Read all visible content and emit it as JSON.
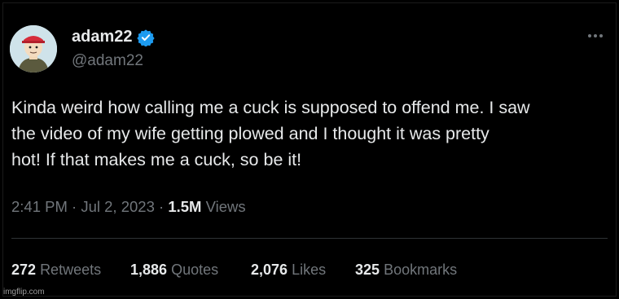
{
  "tweet": {
    "display_name": "adam22",
    "handle": "@adam22",
    "verified_color": "#1d9bf0",
    "avatar_icon": "cartoon-avatar-icon",
    "text": "Kinda weird how calling me a cuck is supposed to offend me. I saw\nthe video of my wife getting plowed and I thought it was pretty\nhot! If that makes me a cuck, so be it!",
    "time": "2:41 PM",
    "date": "Jul 2, 2023",
    "separator": "·",
    "views_count": "1.5M",
    "views_label": "Views"
  },
  "stats": {
    "retweets_count": "272",
    "retweets_label": "Retweets",
    "quotes_count": "1,886",
    "quotes_label": "Quotes",
    "likes_count": "2,076",
    "likes_label": "Likes",
    "bookmarks_count": "325",
    "bookmarks_label": "Bookmarks"
  },
  "watermark": "imgflip.com",
  "colors": {
    "background": "#000000",
    "primary_text": "#e7e9ea",
    "secondary_text": "#71767b",
    "divider": "#2f3336"
  }
}
